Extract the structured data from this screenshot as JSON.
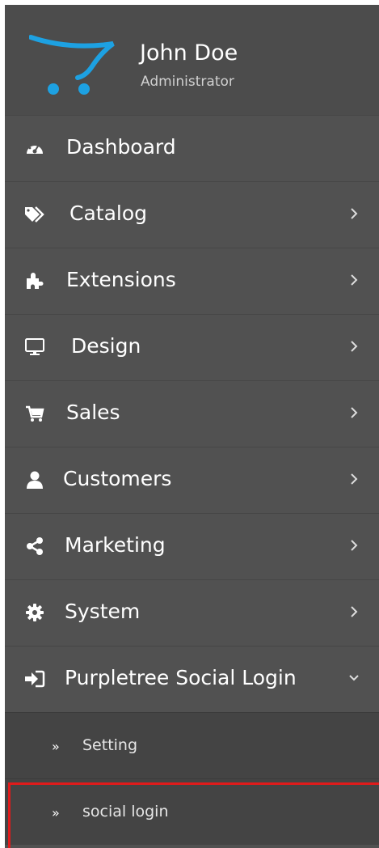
{
  "profile": {
    "name": "John Doe",
    "role": "Administrator"
  },
  "menu": [
    {
      "label": "Dashboard",
      "icon": "dashboard-icon",
      "has_chevron": false
    },
    {
      "label": "Catalog",
      "icon": "tags-icon",
      "has_chevron": true
    },
    {
      "label": "Extensions",
      "icon": "puzzle-icon",
      "has_chevron": true
    },
    {
      "label": "Design",
      "icon": "desktop-icon",
      "has_chevron": true
    },
    {
      "label": "Sales",
      "icon": "cart-icon",
      "has_chevron": true
    },
    {
      "label": "Customers",
      "icon": "user-icon",
      "has_chevron": true
    },
    {
      "label": "Marketing",
      "icon": "share-icon",
      "has_chevron": true
    },
    {
      "label": "System",
      "icon": "gear-icon",
      "has_chevron": true
    },
    {
      "label": "Purpletree Social Login",
      "icon": "sign-in-icon",
      "has_chevron": true,
      "expanded": true
    }
  ],
  "submenu": [
    {
      "label": "Setting",
      "icon": "double-chevron-right-icon"
    },
    {
      "label": "social login",
      "icon": "double-chevron-right-icon",
      "highlighted": true
    }
  ],
  "colors": {
    "sidebar_bg": "#515151",
    "submenu_bg": "#444444",
    "highlight_border": "#e01b1b",
    "logo_blue": "#1da1e2"
  }
}
